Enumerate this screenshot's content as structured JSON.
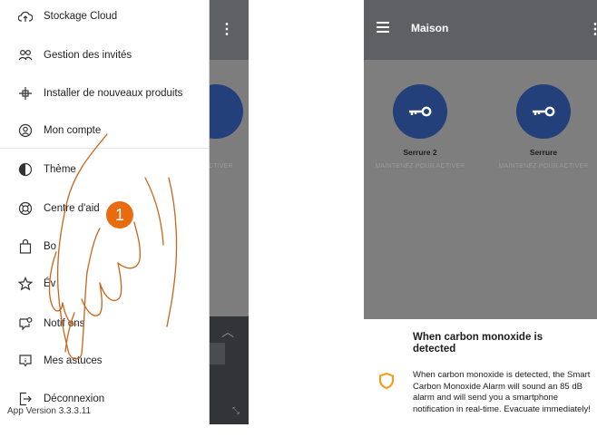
{
  "left_screen": {
    "menu_items": [
      {
        "label": "Stockage Cloud",
        "icon": "cloud-upload-icon"
      },
      {
        "label": "Gestion des invités",
        "icon": "guests-icon"
      },
      {
        "label": "Installer de nouveaux produits",
        "icon": "plug-icon"
      },
      {
        "label": "Mon compte",
        "icon": "account-icon"
      },
      {
        "label": "Thème",
        "icon": "theme-icon"
      },
      {
        "label": "Centre d'aid",
        "icon": "help-center-icon"
      },
      {
        "label": "Bo",
        "icon": "shop-bag-icon"
      },
      {
        "label": "Év",
        "icon": "star-icon"
      },
      {
        "label": "Notif    ons",
        "icon": "notification-icon"
      },
      {
        "label": "Mes astuces",
        "icon": "tips-icon"
      },
      {
        "label": "Déconnexion",
        "icon": "logout-icon"
      }
    ],
    "app_version": "App Version 3.3.3.11",
    "background_subtext": "CTIVER",
    "step_badge": "1"
  },
  "right_screen": {
    "title": "Maison",
    "locks": [
      {
        "name": "Serrure 2",
        "hint": "MAINTENEZ POUR ACTIVER"
      },
      {
        "name": "Serrure",
        "hint": "MAINTENEZ POUR ACTIVER"
      }
    ],
    "notification": {
      "title": "When carbon monoxide is detected",
      "body": "When carbon monoxide is detected, the Smart Carbon Monoxide Alarm will sound an 85 dB alarm and will send you a smartphone notification in real-time. Evacuate immediately!"
    }
  },
  "colors": {
    "header": "#5f6064",
    "overlay": "#7e7e7e",
    "lock_circle": "#23407a",
    "badge": "#e86b10",
    "warning_shield": "#f0a020"
  }
}
